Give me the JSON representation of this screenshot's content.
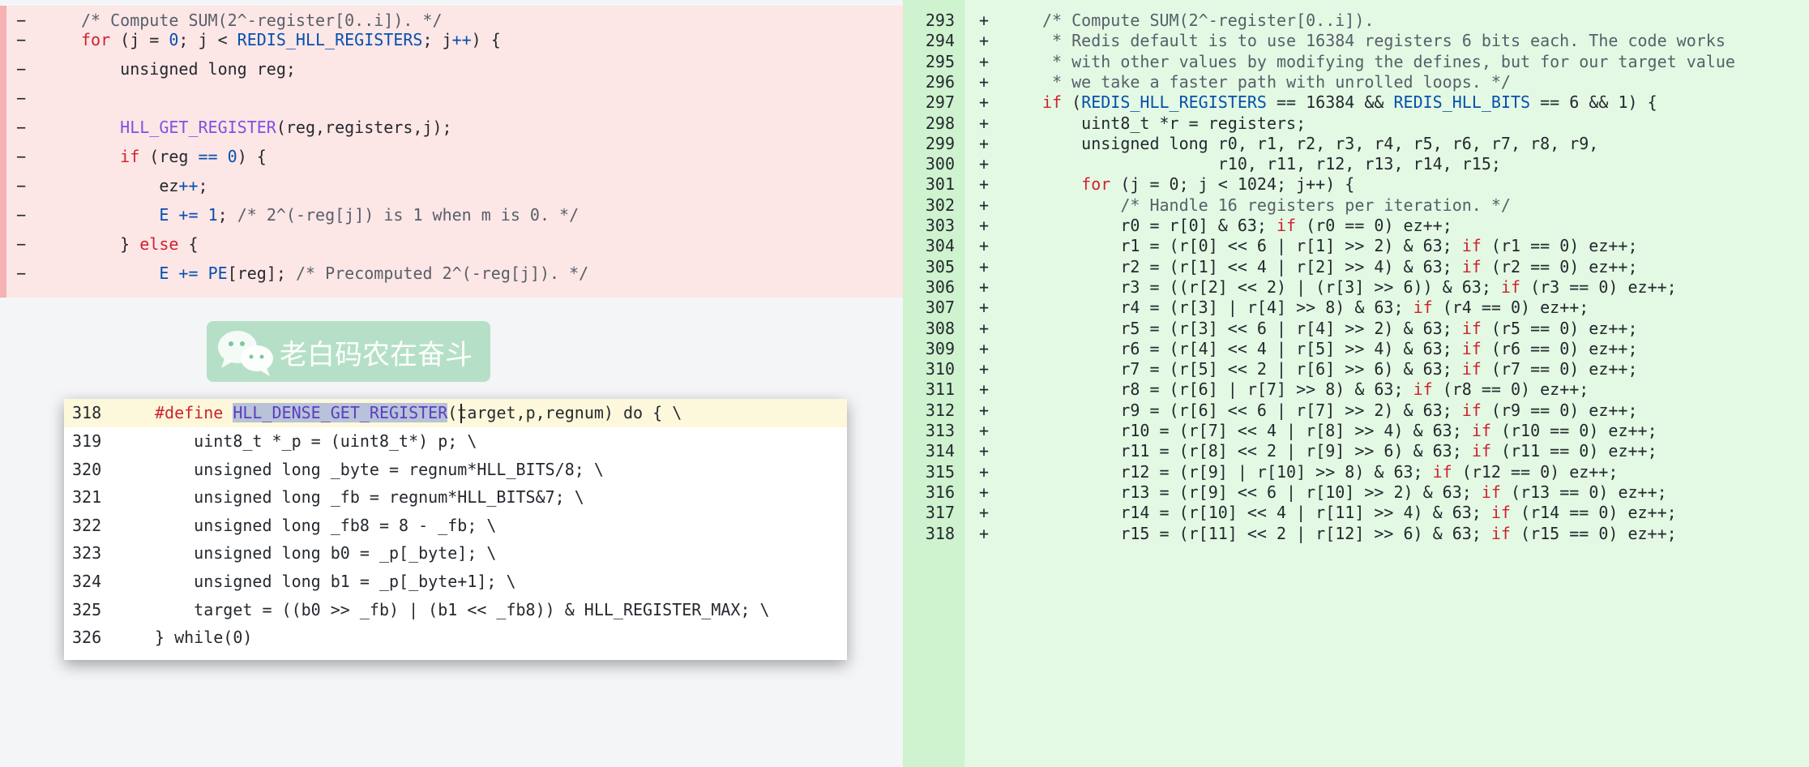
{
  "left": {
    "lines": [
      {
        "sign": "−",
        "code": "/* Compute SUM(2^-register[0..i]). */"
      },
      {
        "sign": "−",
        "code": "for (j = 0; j < REDIS_HLL_REGISTERS; j++) {"
      },
      {
        "sign": "−",
        "code": "    unsigned long reg;"
      },
      {
        "sign": "−",
        "code": ""
      },
      {
        "sign": "−",
        "code": "    HLL_GET_REGISTER(reg,registers,j);"
      },
      {
        "sign": "−",
        "code": "    if (reg == 0) {"
      },
      {
        "sign": "−",
        "code": "        ez++;"
      },
      {
        "sign": "−",
        "code": "        E += 1; /* 2^(-reg[j]) is 1 when m is 0. */"
      },
      {
        "sign": "−",
        "code": "    } else {"
      },
      {
        "sign": "−",
        "code": "        E += PE[reg]; /* Precomputed 2^(-reg[j]). */"
      }
    ]
  },
  "right": {
    "lines": [
      {
        "ln": "293",
        "sign": "+",
        "code": "/* Compute SUM(2^-register[0..i])."
      },
      {
        "ln": "294",
        "sign": "+",
        "code": " * Redis default is to use 16384 registers 6 bits each. The code works"
      },
      {
        "ln": "295",
        "sign": "+",
        "code": " * with other values by modifying the defines, but for our target value"
      },
      {
        "ln": "296",
        "sign": "+",
        "code": " * we take a faster path with unrolled loops. */"
      },
      {
        "ln": "297",
        "sign": "+",
        "code": "if (REDIS_HLL_REGISTERS == 16384 && REDIS_HLL_BITS == 6 && 1) {"
      },
      {
        "ln": "298",
        "sign": "+",
        "code": "    uint8_t *r = registers;"
      },
      {
        "ln": "299",
        "sign": "+",
        "code": "    unsigned long r0, r1, r2, r3, r4, r5, r6, r7, r8, r9,"
      },
      {
        "ln": "300",
        "sign": "+",
        "code": "                  r10, r11, r12, r13, r14, r15;"
      },
      {
        "ln": "301",
        "sign": "+",
        "code": "    for (j = 0; j < 1024; j++) {"
      },
      {
        "ln": "302",
        "sign": "+",
        "code": "        /* Handle 16 registers per iteration. */"
      },
      {
        "ln": "303",
        "sign": "+",
        "code": "        r0 = r[0] & 63; if (r0 == 0) ez++;"
      },
      {
        "ln": "304",
        "sign": "+",
        "code": "        r1 = (r[0] << 6 | r[1] >> 2) & 63; if (r1 == 0) ez++;"
      },
      {
        "ln": "305",
        "sign": "+",
        "code": "        r2 = (r[1] << 4 | r[2] >> 4) & 63; if (r2 == 0) ez++;"
      },
      {
        "ln": "306",
        "sign": "+",
        "code": "        r3 = ((r[2] << 2) | (r[3] >> 6)) & 63; if (r3 == 0) ez++;"
      },
      {
        "ln": "307",
        "sign": "+",
        "code": "        r4 = (r[3] | r[4] >> 8) & 63; if (r4 == 0) ez++;"
      },
      {
        "ln": "308",
        "sign": "+",
        "code": "        r5 = (r[3] << 6 | r[4] >> 2) & 63; if (r5 == 0) ez++;"
      },
      {
        "ln": "309",
        "sign": "+",
        "code": "        r6 = (r[4] << 4 | r[5] >> 4) & 63; if (r6 == 0) ez++;"
      },
      {
        "ln": "310",
        "sign": "+",
        "code": "        r7 = (r[5] << 2 | r[6] >> 6) & 63; if (r7 == 0) ez++;"
      },
      {
        "ln": "311",
        "sign": "+",
        "code": "        r8 = (r[6] | r[7] >> 8) & 63; if (r8 == 0) ez++;"
      },
      {
        "ln": "312",
        "sign": "+",
        "code": "        r9 = (r[6] << 6 | r[7] >> 2) & 63; if (r9 == 0) ez++;"
      },
      {
        "ln": "313",
        "sign": "+",
        "code": "        r10 = (r[7] << 4 | r[8] >> 4) & 63; if (r10 == 0) ez++;"
      },
      {
        "ln": "314",
        "sign": "+",
        "code": "        r11 = (r[8] << 2 | r[9] >> 6) & 63; if (r11 == 0) ez++;"
      },
      {
        "ln": "315",
        "sign": "+",
        "code": "        r12 = (r[9] | r[10] >> 8) & 63; if (r12 == 0) ez++;"
      },
      {
        "ln": "316",
        "sign": "+",
        "code": "        r13 = (r[9] << 6 | r[10] >> 2) & 63; if (r13 == 0) ez++;"
      },
      {
        "ln": "317",
        "sign": "+",
        "code": "        r14 = (r[10] << 4 | r[11] >> 4) & 63; if (r14 == 0) ez++;"
      },
      {
        "ln": "318",
        "sign": "+",
        "code": "        r15 = (r[11] << 2 | r[12] >> 6) & 63; if (r15 == 0) ez++;"
      }
    ]
  },
  "watermark": {
    "text": "老白码农在奋斗",
    "icon": "wechat-icon"
  },
  "popup": {
    "highlighted_symbol": "HLL_DENSE_GET_REGISTER",
    "define_keyword": "#define",
    "define_rest": "(target,p,regnum) do { \\",
    "define_line_number": "318",
    "lines": [
      {
        "ln": "319",
        "code": "    uint8_t *_p = (uint8_t*) p; \\"
      },
      {
        "ln": "320",
        "code": "    unsigned long _byte = regnum*HLL_BITS/8; \\"
      },
      {
        "ln": "321",
        "code": "    unsigned long _fb = regnum*HLL_BITS&7; \\"
      },
      {
        "ln": "322",
        "code": "    unsigned long _fb8 = 8 - _fb; \\"
      },
      {
        "ln": "323",
        "code": "    unsigned long b0 = _p[_byte]; \\"
      },
      {
        "ln": "324",
        "code": "    unsigned long b1 = _p[_byte+1]; \\"
      },
      {
        "ln": "325",
        "code": "    target = ((b0 >> _fb) | (b1 << _fb8)) & HLL_REGISTER_MAX; \\"
      },
      {
        "ln": "326",
        "code": "} while(0)"
      }
    ]
  },
  "colors": {
    "deleted_bg": "#fde6e6",
    "added_bg": "#e3f9e3",
    "keyword": "#cf222e",
    "type": "#0550ae",
    "function": "#8250df",
    "comment": "#57606a"
  }
}
